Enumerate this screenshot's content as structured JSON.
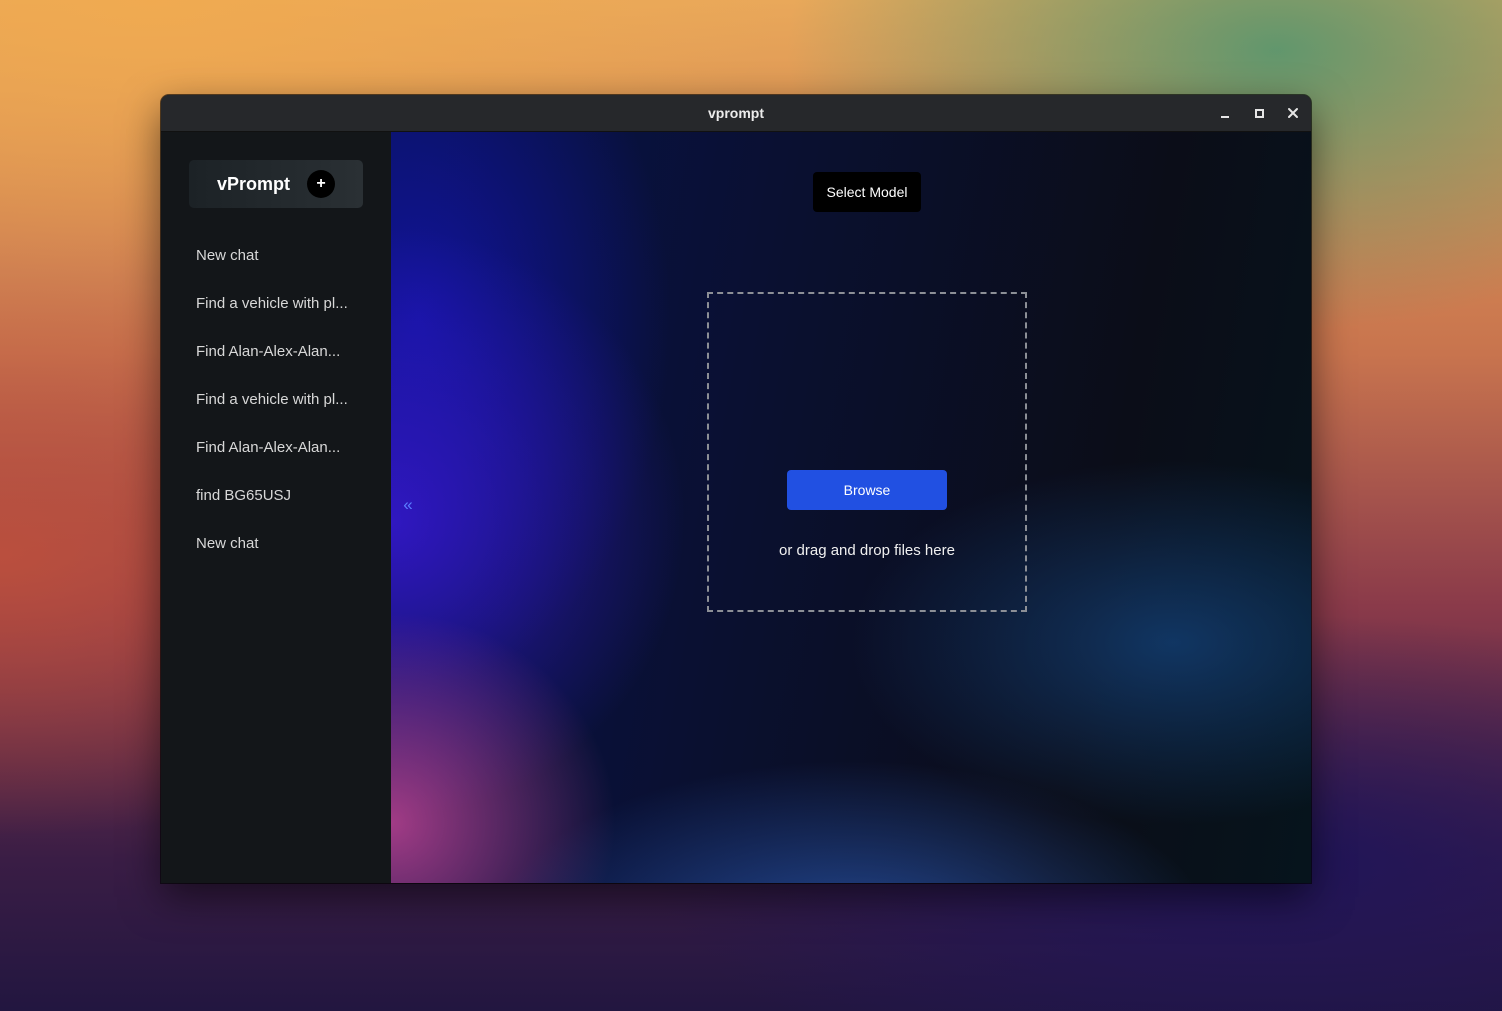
{
  "window": {
    "title": "vprompt",
    "controls": {
      "minimize_icon": "minimize-icon",
      "maximize_icon": "maximize-icon",
      "close_icon": "close-icon"
    }
  },
  "sidebar": {
    "brand": "vPrompt",
    "new_chat_icon": "+",
    "chats": [
      "New chat",
      "Find a vehicle with pl...",
      "Find Alan-Alex-Alan...",
      "Find a vehicle with pl...",
      "Find Alan-Alex-Alan...",
      "find BG65USJ",
      "New chat"
    ]
  },
  "main": {
    "select_model_label": "Select Model",
    "collapse_icon": "«",
    "dropzone": {
      "browse_label": "Browse",
      "hint": "or drag and drop files here"
    }
  },
  "colors": {
    "accent": "#2150e2",
    "sidebar_bg": "#131619",
    "titlebar_bg": "#26282b"
  }
}
